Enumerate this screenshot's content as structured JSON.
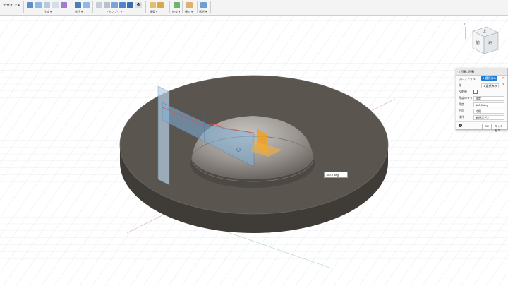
{
  "toolbar": {
    "workspace": "デザイン ▾",
    "groups": [
      "作成 ▾",
      "修正 ▾",
      "アセンブリ ▾",
      "構築 ▾",
      "検査 ▾",
      "挿入 ▾",
      "選択 ▾"
    ]
  },
  "viewcube": {
    "axis_z": "Z",
    "face_top": "上",
    "face_front": "前",
    "face_right": "右"
  },
  "revolve_dialog": {
    "title": "▸ 回転: 回転",
    "profile_label": "プロファイル",
    "profile_value": "1 選択済み",
    "axis_label": "軸",
    "axis_value": "1 選択済み",
    "project_label": "投影軸",
    "type_label": "角度のタイプ",
    "type_value": "角度",
    "angle_label": "角度",
    "angle_value": "180.0 deg",
    "direction_label": "方向",
    "direction_value": "片側",
    "operation_label": "操作",
    "operation_value": "新規ボディ",
    "ok": "OK",
    "cancel": "キャンセル"
  },
  "canvas": {
    "angle_input": "180.0 deg"
  },
  "colors": {
    "accent": "#1f7bd6",
    "body": "#5a554f",
    "sketch_plane": "#7fb0d8",
    "manipulator": "#f0a020"
  }
}
